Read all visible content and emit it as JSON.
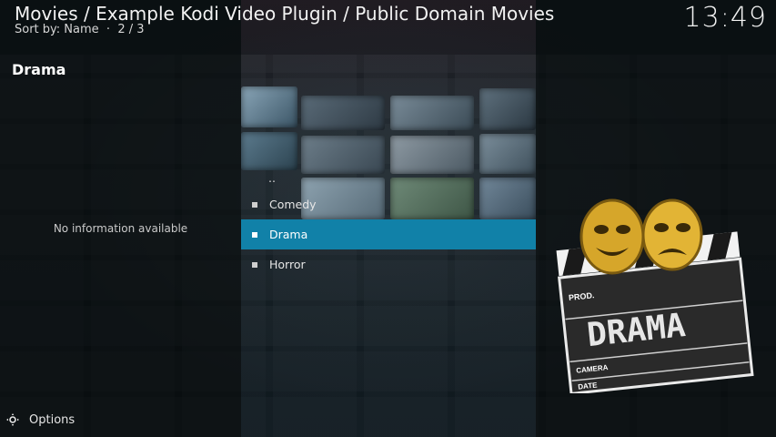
{
  "header": {
    "breadcrumb": "Movies / Example Kodi Video Plugin / Public Domain Movies",
    "sort_label": "Sort by: Name",
    "separator": "·",
    "position": "2 / 3",
    "clock": "13:49"
  },
  "info_panel": {
    "title": "Drama",
    "no_info": "No information available"
  },
  "list": {
    "parent": "..",
    "items": [
      {
        "label": "Comedy"
      },
      {
        "label": "Drama",
        "selected": true
      },
      {
        "label": "Horror"
      }
    ]
  },
  "poster": {
    "text": "DRAMA",
    "prod_label": "PROD.",
    "camera_label": "CAMERA",
    "date_label": "DATE"
  },
  "footer": {
    "options_label": "Options",
    "icon": "options-icon"
  },
  "colors": {
    "accent": "#1181a8",
    "background": "#0c1418"
  }
}
